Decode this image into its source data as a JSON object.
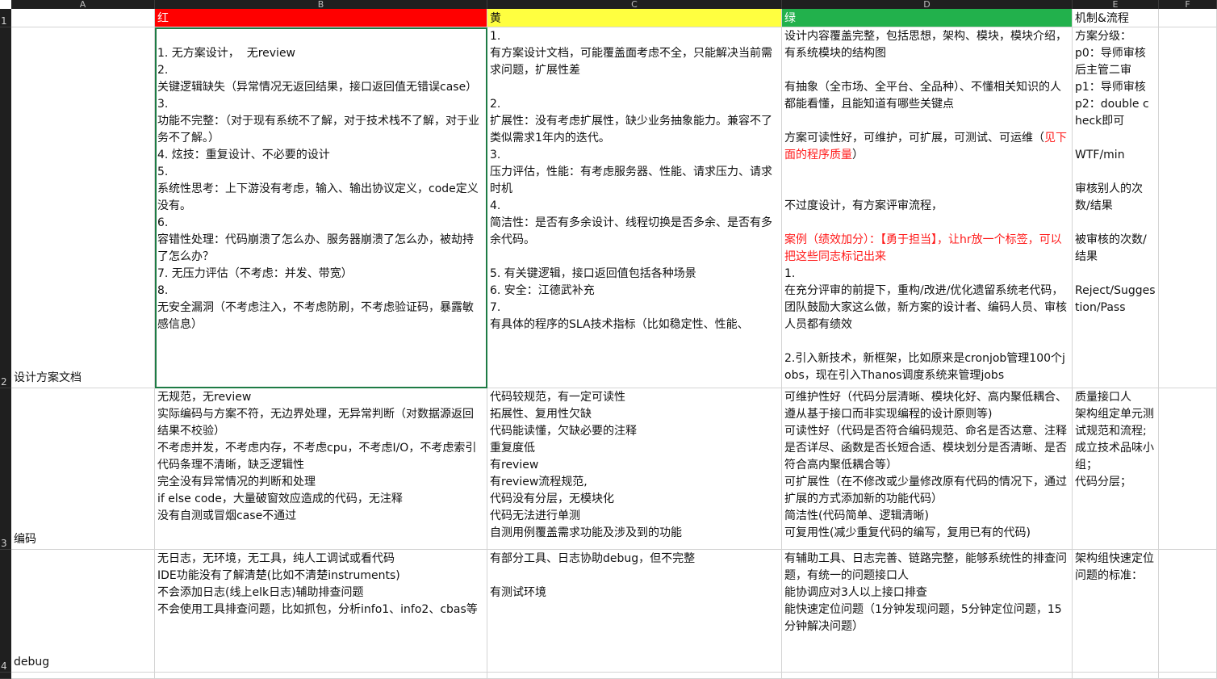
{
  "column_headers": [
    "A",
    "B",
    "C",
    "D",
    "E",
    "F"
  ],
  "row_headers": [
    "1",
    "2",
    "3",
    "4"
  ],
  "header_row": {
    "a": "",
    "red": "红",
    "yellow": "黄",
    "green": "绿",
    "mechanism": "机制&流程"
  },
  "fill_colors": {
    "red": "#ff0000",
    "yellow": "#ffff40",
    "green": "#22b14c",
    "selection": "#1e7b45",
    "highlight_text": "#ff1a1a"
  },
  "rows": [
    {
      "label": "设计方案文档",
      "red": "\n1. 无方案设计，  无review\n2.\n关键逻辑缺失（异常情况无返回结果，接口返回值无错误case）\n3.\n功能不完整：（对于现有系统不了解，对于技术栈不了解，对于业务不了解。）\n4. 炫技：重复设计、不必要的设计\n5.\n系统性思考：上下游没有考虑，输入、输出协议定义，code定义没有。\n6.\n容错性处理：代码崩溃了怎么办、服务器崩溃了怎么办，被劫持了怎么办？\n7. 无压力评估（不考虑：并发、带宽）\n8.\n无安全漏洞（不考虑注入，不考虑防刷，不考虑验证码，暴露敏感信息）",
      "yellow": "1.\n有方案设计文档，可能覆盖面考虑不全，只能解决当前需求问题，扩展性差\n\n2.\n扩展性：没有考虑扩展性，缺少业务抽象能力。兼容不了类似需求1年内的迭代。\n3.\n压力评估，性能：有考虑服务器、性能、请求压力、请求时机\n4.\n简洁性：是否有多余设计、线程切换是否多余、是否有多余代码。\n\n5. 有关键逻辑，接口返回值包括各种场景\n6. 安全：江德武补充\n7.\n有具体的程序的SLA技术指标（比如稳定性、性能、",
      "green_before": "设计内容覆盖完整，包括思想，架构、模块，模块介绍，有系统模块的结构图\n\n有抽象（全市场、全平台、全品种）、不懂相关知识的人都能看懂，且能知道有哪些关键点\n\n方案可读性好，可维护，可扩展，可测试、可运维（",
      "green_red_1": "见下面的程序质量",
      "green_middle": "）\n\n\n不过度设计，有方案评审流程，\n\n",
      "green_red_2": "案例（绩效加分）：【勇于担当】，让hr放一个标签，可以把这些同志标记出来",
      "green_after": "\n1.\n在充分评审的前提下，重构/改进/优化遗留系统老代码，团队鼓励大家这么做，新方案的设计者、编码人员、审核人员都有绩效\n\n2.引入新技术，新框架，比如原来是cronjob管理100个jobs，现在引入Thanos调度系统来管理jobs",
      "mechanism": "方案分级：\np0：导师审核后主管二审\np1：导师审核\np2：double check即可\n\nWTF/min\n\n审核别人的次数/结果\n\n被审核的次数/结果\n\nReject/Suggestion/Pass"
    },
    {
      "label": "编码",
      "red": "无规范，无review\n实际编码与方案不符，无边界处理，无异常判断（对数据源返回结果不校验）\n不考虑并发，不考虑内存，不考虑cpu，不考虑I/O，不考虑索引\n代码条理不清晰，缺乏逻辑性\n完全没有异常情况的判断和处理\nif else code，大量破窗效应造成的代码，无注释\n没有自测或冒烟case不通过",
      "yellow": "代码较规范，有一定可读性\n拓展性、复用性欠缺\n代码能读懂，欠缺必要的注释\n重复度低\n有review\n有review流程规范,\n代码没有分层，无模块化\n代码无法进行单测\n自测用例覆盖需求功能及涉及到的功能",
      "green": "可维护性好（代码分层清晰、模块化好、高内聚低耦合、遵从基于接口而非实现编程的设计原则等)\n可读性好（代码是否符合编码规范、命名是否达意、注释是否详尽、函数是否长短合适、模块划分是否清晰、是否符合高内聚低耦合等）\n可扩展性（在不修改或少量修改原有代码的情况下，通过扩展的方式添加新的功能代码）\n简洁性(代码简单、逻辑清晰)\n可复用性(减少重复代码的编写，复用已有的代码)",
      "mechanism": "质量接口人\n架构组定单元测试规范和流程;\n成立技术品味小组；\n代码分层；"
    },
    {
      "label": "debug",
      "red": "无日志，无环境，无工具，纯人工调试或看代码\nIDE功能没有了解清楚(比如不清楚instruments)\n不会添加日志(线上elk日志)辅助排查问题\n不会使用工具排查问题，比如抓包，分析info1、info2、cbas等",
      "yellow": "有部分工具、日志协助debug，但不完整\n\n有测试环境",
      "green": "有辅助工具、日志完善、链路完整，能够系统性的排查问题，有统一的问题接口人\n能协调应对3人以上接口排查\n能快速定位问题（1分钟发现问题，5分钟定位问题，15分钟解决问题）",
      "mechanism": "架构组快速定位问题的标准："
    }
  ]
}
